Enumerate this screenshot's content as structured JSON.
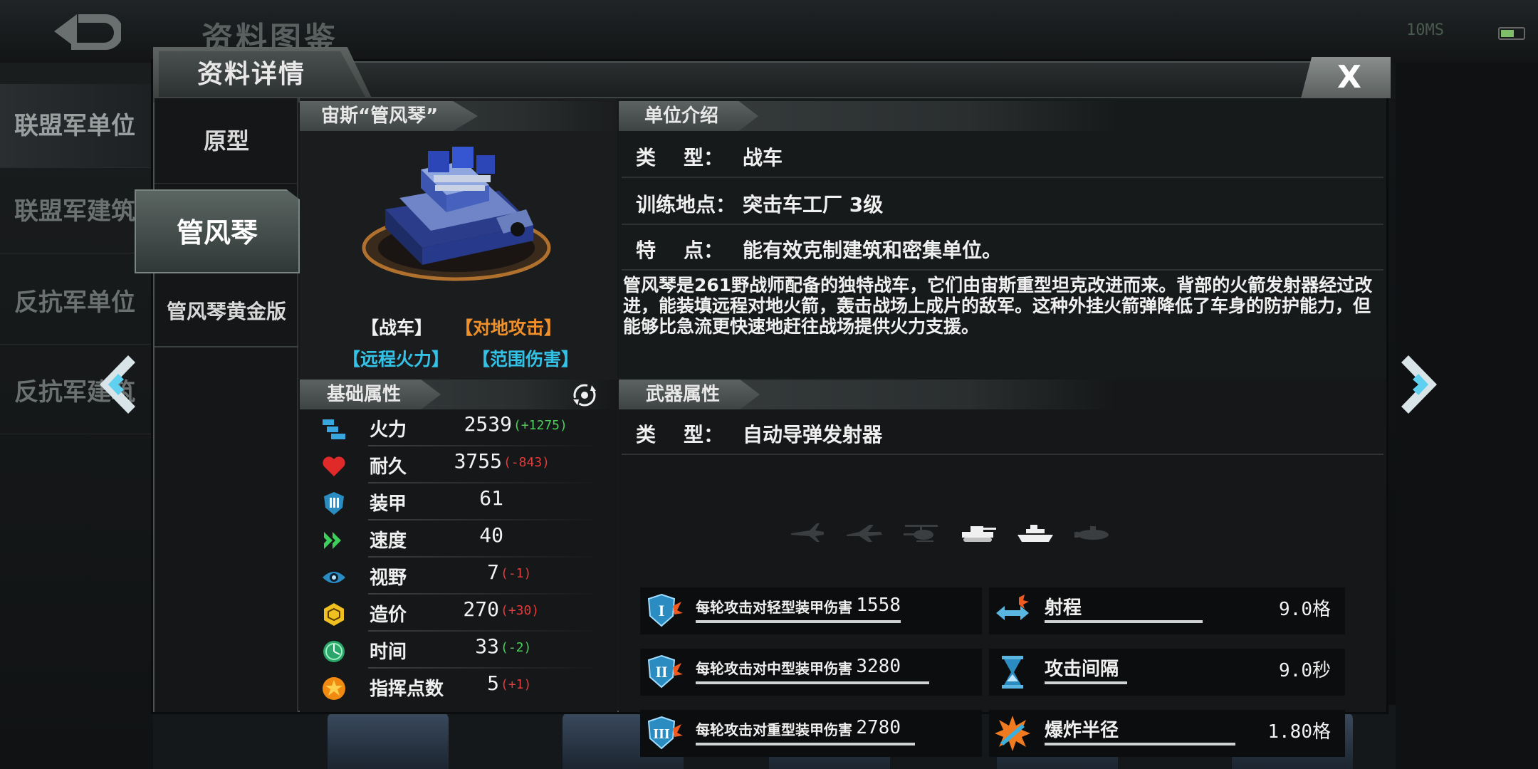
{
  "background": {
    "screen_title": "资料图鉴",
    "network_label": "10MS",
    "side_items": [
      {
        "label": "联盟军单位"
      },
      {
        "label": "联盟军建筑"
      },
      {
        "label": "反抗军单位"
      },
      {
        "label": "反抗军建筑"
      }
    ]
  },
  "dialog": {
    "title": "资料详情",
    "close_label": "X",
    "tabs": [
      {
        "label": "原型",
        "active": false
      },
      {
        "label": "管风琴",
        "active": true
      },
      {
        "label": "管风琴黄金版",
        "active": false
      }
    ]
  },
  "unit": {
    "name": "宙斯“管风琴”",
    "tags": [
      {
        "text": "【战车】",
        "color": "#f0f0f0"
      },
      {
        "text": "【对地攻击】",
        "color": "#f0902a"
      },
      {
        "text": "【远程火力】",
        "color": "#34c1e6"
      },
      {
        "text": "【范围伤害】",
        "color": "#34c1e6"
      }
    ]
  },
  "base_stats": {
    "title": "基础属性",
    "rows": [
      {
        "icon": "firepower-icon",
        "label": "火力",
        "value": "2539",
        "delta": "(+1275)",
        "delta_type": "pos"
      },
      {
        "icon": "heart-icon",
        "label": "耐久",
        "value": "3755",
        "delta": "(-843)",
        "delta_type": "neg"
      },
      {
        "icon": "shield-icon",
        "label": "装甲",
        "value": "61",
        "delta": "",
        "delta_type": ""
      },
      {
        "icon": "speed-chevrons-icon",
        "label": "速度",
        "value": "40",
        "delta": "",
        "delta_type": ""
      },
      {
        "icon": "eye-icon",
        "label": "视野",
        "value": "7",
        "delta": "(-1)",
        "delta_type": "neg"
      },
      {
        "icon": "cube-icon",
        "label": "造价",
        "value": "270",
        "delta": "(+30)",
        "delta_type": "neg"
      },
      {
        "icon": "clock-icon",
        "label": "时间",
        "value": "33",
        "delta": "(-2)",
        "delta_type": "pos"
      },
      {
        "icon": "star-medal-icon",
        "label": "指挥点数",
        "value": "5",
        "delta": "(+1)",
        "delta_type": "neg"
      }
    ]
  },
  "intro": {
    "title": "单位介绍",
    "rows": [
      {
        "key": "类    型：",
        "value": "战车"
      },
      {
        "key": "训练地点：",
        "value": "突击车工厂 3级"
      },
      {
        "key": "特    点：",
        "value": "能有效克制建筑和密集单位。"
      }
    ],
    "description": "管风琴是261野战师配备的独特战车，它们由宙斯重型坦克改进而来。背部的火箭发射器经过改进，能装填远程对地火箭，轰击战场上成片的敌军。这种外挂火箭弹降低了车身的防护能力，但能够比急流更快速地赶往战场提供火力支援。"
  },
  "weapon": {
    "title": "武器属性",
    "type_key": "类    型：",
    "type_value": "自动导弹发射器",
    "targets": [
      {
        "icon": "fighter-jet-icon",
        "active": false
      },
      {
        "icon": "bomber-jet-icon",
        "active": false
      },
      {
        "icon": "helicopter-icon",
        "active": false
      },
      {
        "icon": "tank-icon",
        "active": true
      },
      {
        "icon": "ship-icon",
        "active": true
      },
      {
        "icon": "submarine-icon",
        "active": false
      }
    ],
    "damage": [
      {
        "icon": "armor-light-icon",
        "label": "每轮攻击对轻型装甲伤害",
        "value": "1558"
      },
      {
        "icon": "armor-medium-icon",
        "label": "每轮攻击对中型装甲伤害",
        "value": "3280"
      },
      {
        "icon": "armor-heavy-icon",
        "label": "每轮攻击对重型装甲伤害",
        "value": "2780"
      }
    ],
    "props": [
      {
        "icon": "range-arrow-icon",
        "label": "射程",
        "value": "9.0格"
      },
      {
        "icon": "hourglass-icon",
        "label": "攻击间隔",
        "value": "9.0秒"
      },
      {
        "icon": "explosion-icon",
        "label": "爆炸半径",
        "value": "1.80格"
      }
    ]
  }
}
